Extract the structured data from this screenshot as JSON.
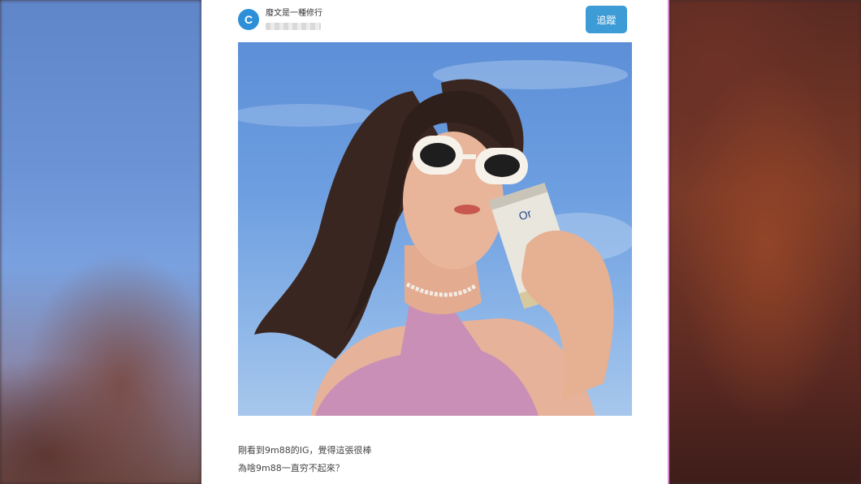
{
  "post": {
    "avatar_letter": "C",
    "author_name": "廢文是一種修行",
    "follow_label": "追蹤",
    "photo_alt": "photo-of-woman-with-sunglasses-and-can",
    "caption_lines": [
      "剛看到9m88的IG，覺得這張很棒",
      "為啥9m88一直穷不起來？"
    ]
  },
  "colors": {
    "accent": "#3d9bd6",
    "avatar_bg": "#2d8fd8",
    "divider": "#d98ad0"
  }
}
